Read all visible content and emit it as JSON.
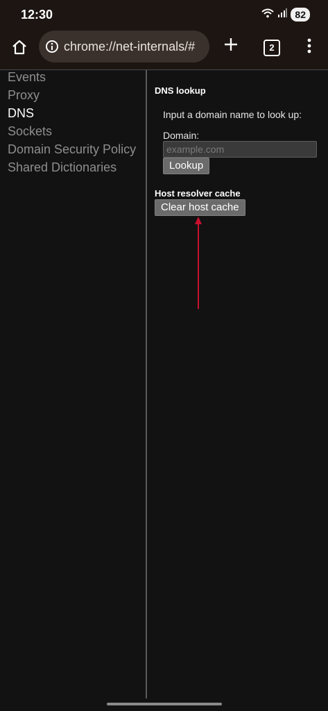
{
  "status_bar": {
    "time": "12:30",
    "battery": "82",
    "icons": [
      "wifi-icon",
      "signal-icon"
    ]
  },
  "toolbar": {
    "url": "chrome://net-internals/#",
    "tab_count": "2",
    "icons": [
      "home-icon",
      "info-icon",
      "plus-icon",
      "menu-icon"
    ]
  },
  "sidebar": {
    "items": [
      {
        "label": "Events"
      },
      {
        "label": "Proxy"
      },
      {
        "label": "DNS"
      },
      {
        "label": "Sockets"
      },
      {
        "label": "Domain Security Policy"
      },
      {
        "label": "Shared Dictionaries"
      }
    ],
    "active": "DNS"
  },
  "dns": {
    "heading": "DNS lookup",
    "instruction": "Input a domain name to look up:",
    "domain_label": "Domain:",
    "domain_placeholder": "example.com",
    "domain_value": "",
    "lookup_label": "Lookup"
  },
  "cache": {
    "heading": "Host resolver cache",
    "clear_label": "Clear host cache"
  },
  "colors": {
    "background": "#121212",
    "toolbar": "#1c1512",
    "annotation_arrow": "#c8102e"
  }
}
